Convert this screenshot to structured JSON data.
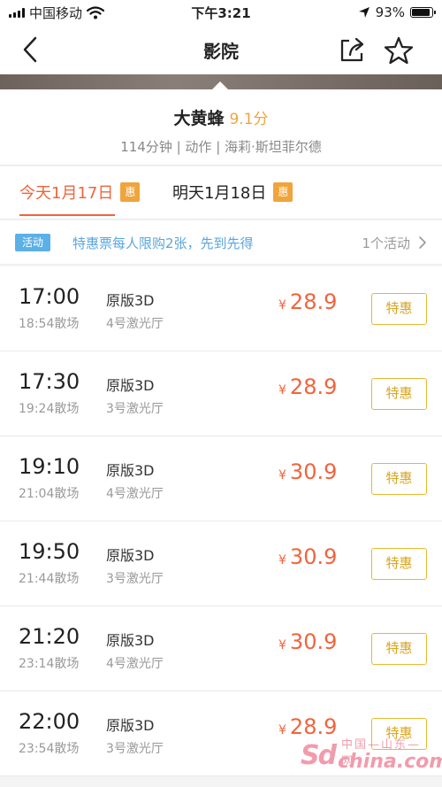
{
  "status_bar": {
    "carrier": "中国移动",
    "time": "下午3:21",
    "battery_text": "93%",
    "battery_level": 0.93,
    "icons": [
      "signal-icon",
      "wifi-icon",
      "location-arrow-icon",
      "battery-icon"
    ]
  },
  "nav": {
    "title": "影院",
    "icons": [
      "back-chevron-icon",
      "share-icon",
      "star-icon"
    ]
  },
  "movie": {
    "title": "大黄蜂",
    "score": "9.1分",
    "meta": "114分钟 | 动作 | 海莉·斯坦菲尔德"
  },
  "date_tabs": [
    {
      "label": "今天1月17日",
      "badge": "惠",
      "active": true
    },
    {
      "label": "明天1月18日",
      "badge": "惠",
      "active": false
    }
  ],
  "promo": {
    "tag": "活动",
    "text": "特惠票每人限购2张，先到先得",
    "count": "1个活动"
  },
  "showtimes": [
    {
      "start": "17:00",
      "end": "18:54散场",
      "version": "原版3D",
      "hall": "4号激光厅",
      "currency": "¥",
      "price": "28.9",
      "button": "特惠"
    },
    {
      "start": "17:30",
      "end": "19:24散场",
      "version": "原版3D",
      "hall": "3号激光厅",
      "currency": "¥",
      "price": "28.9",
      "button": "特惠"
    },
    {
      "start": "19:10",
      "end": "21:04散场",
      "version": "原版3D",
      "hall": "4号激光厅",
      "currency": "¥",
      "price": "30.9",
      "button": "特惠"
    },
    {
      "start": "19:50",
      "end": "21:44散场",
      "version": "原版3D",
      "hall": "3号激光厅",
      "currency": "¥",
      "price": "30.9",
      "button": "特惠"
    },
    {
      "start": "21:20",
      "end": "23:14散场",
      "version": "原版3D",
      "hall": "4号激光厅",
      "currency": "¥",
      "price": "30.9",
      "button": "特惠"
    },
    {
      "start": "22:00",
      "end": "23:54散场",
      "version": "原版3D",
      "hall": "3号激光厅",
      "currency": "¥",
      "price": "28.9",
      "button": "特惠"
    }
  ],
  "watermark": {
    "logo": "Sd",
    "site": "china.com",
    "cn_text": "中国—山东—网"
  },
  "colors": {
    "accent": "#f0643c",
    "score": "#f0a43c",
    "badge": "#f0a43c",
    "promo_tag": "#5bb0e8",
    "deal_border": "#e8b830"
  }
}
